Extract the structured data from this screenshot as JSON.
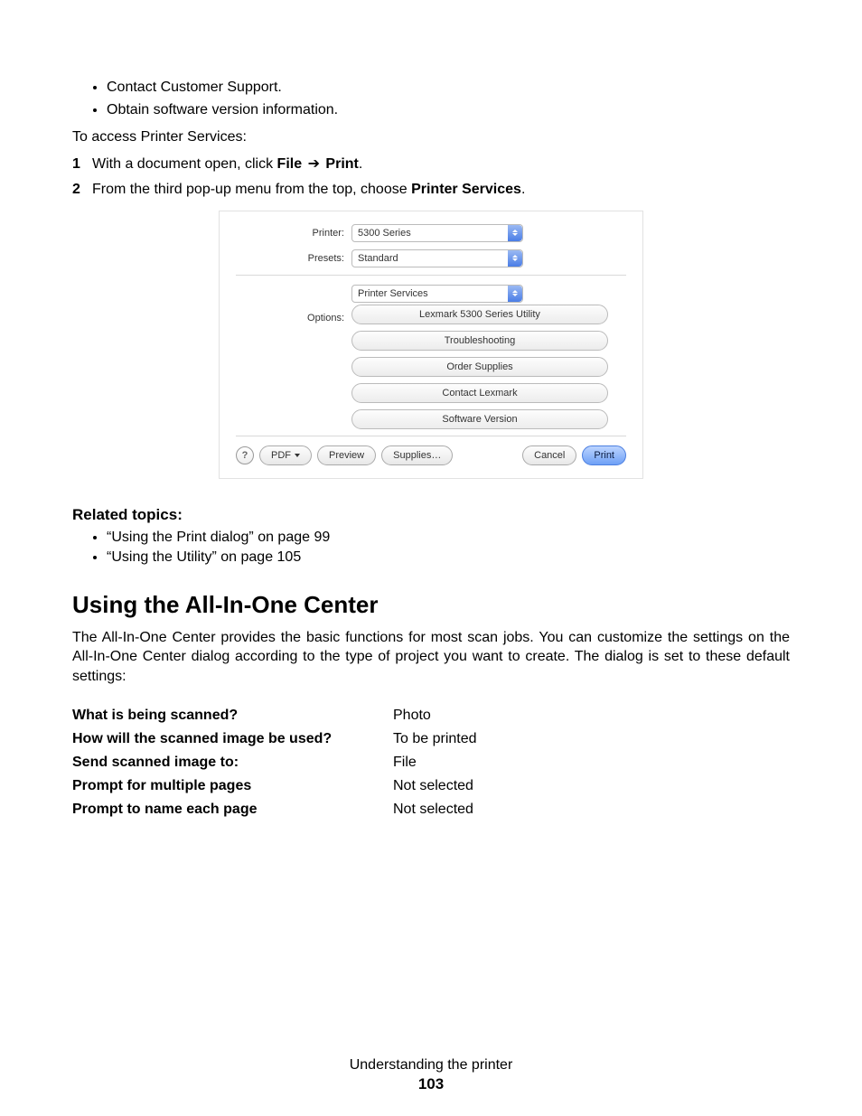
{
  "top_bullets": [
    "Contact Customer Support.",
    "Obtain software version information."
  ],
  "intro_line": "To access Printer Services:",
  "step1": {
    "pre": "With a document open, click ",
    "bold1": "File",
    "arrow": "➔",
    "bold2": "Print",
    "post": "."
  },
  "step2": {
    "pre": "From the third pop-up menu from the top, choose ",
    "bold1": "Printer Services",
    "post": "."
  },
  "dialog": {
    "printer_label": "Printer:",
    "printer_value": "5300 Series",
    "presets_label": "Presets:",
    "presets_value": "Standard",
    "panel_value": "Printer Services",
    "options_label": "Options:",
    "option_buttons": [
      "Lexmark 5300 Series Utility",
      "Troubleshooting",
      "Order Supplies",
      "Contact Lexmark",
      "Software Version"
    ],
    "help_glyph": "?",
    "pdf_label": "PDF",
    "preview_label": "Preview",
    "supplies_label": "Supplies…",
    "cancel_label": "Cancel",
    "print_label": "Print"
  },
  "related": {
    "heading": "Related topics:",
    "items": [
      "“Using the Print dialog” on page 99",
      "“Using the Utility” on page 105"
    ]
  },
  "h2": "Using the All-In-One Center",
  "para": "The All-In-One Center provides the basic functions for most scan jobs. You can customize the settings on the All-In-One Center dialog according to the type of project you want to create. The dialog is set to these default settings:",
  "settings": [
    {
      "label": "What is being scanned?",
      "value": "Photo"
    },
    {
      "label": "How will the scanned image be used?",
      "value": "To be printed"
    },
    {
      "label": "Send scanned image to:",
      "value": "File"
    },
    {
      "label": "Prompt for multiple pages",
      "value": "Not selected"
    },
    {
      "label": "Prompt to name each page",
      "value": "Not selected"
    }
  ],
  "footer": {
    "section": "Understanding the printer",
    "page": "103"
  }
}
